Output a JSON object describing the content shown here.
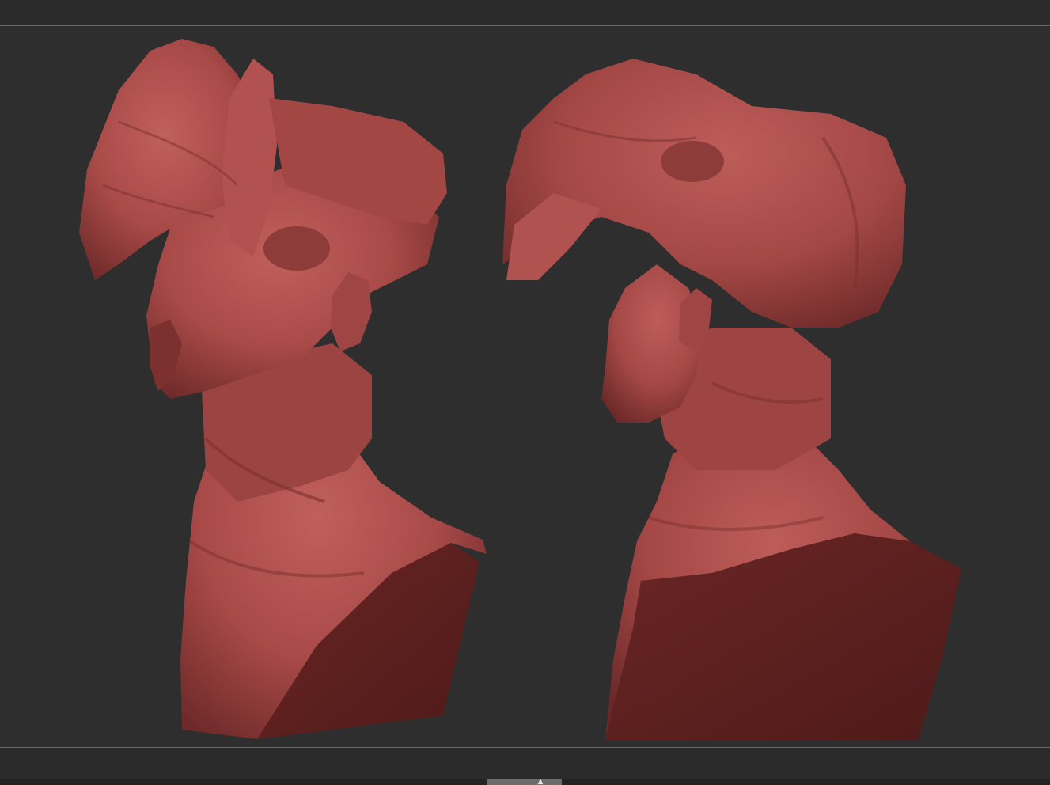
{
  "viewport": {
    "background_color": "#2e2e2e",
    "material_color": "#a84a48",
    "material_shadow_color": "#5a1f1e",
    "models": [
      {
        "name": "creature-bust-three-quarter-view"
      },
      {
        "name": "creature-bust-side-view"
      }
    ]
  },
  "bottom_bar": {
    "scroll_arrow_icon": "chevron-up-icon"
  }
}
